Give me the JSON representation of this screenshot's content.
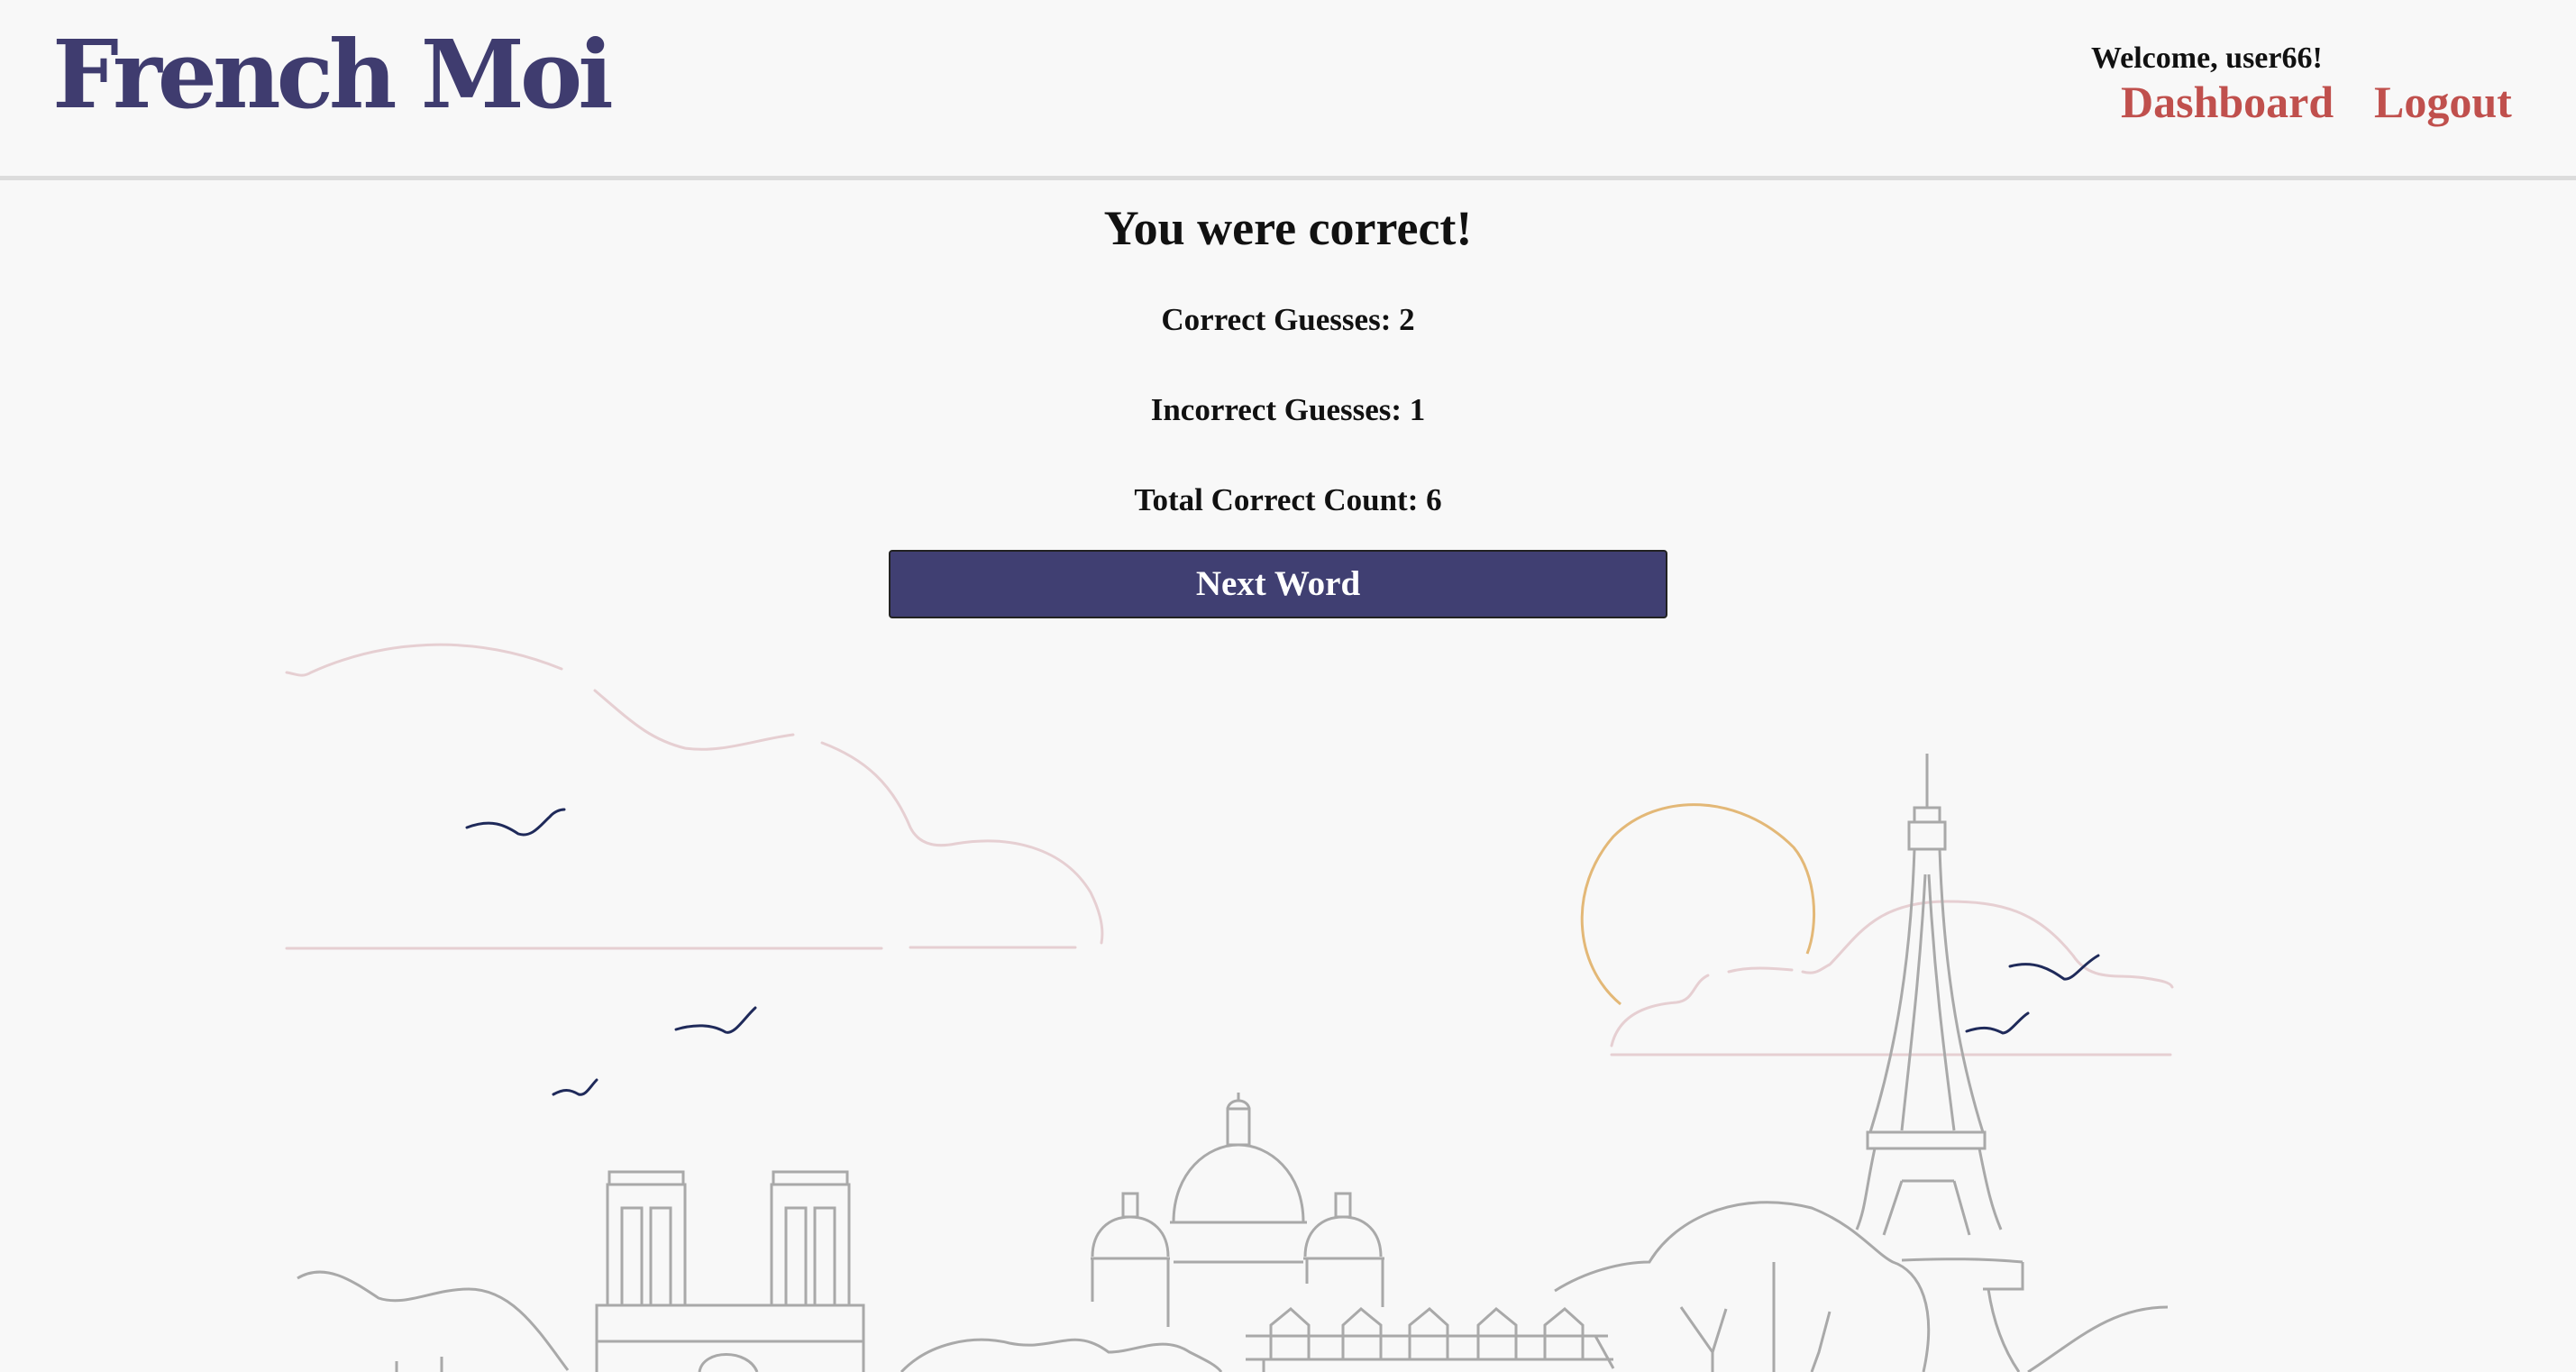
{
  "header": {
    "logo": "French Moi",
    "welcome": "Welcome, user66!",
    "nav": {
      "dashboard": "Dashboard",
      "logout": "Logout"
    }
  },
  "result": {
    "title": "You were correct!",
    "correct_guesses": "Correct Guesses: 2",
    "incorrect_guesses": "Incorrect Guesses: 1",
    "total_correct": "Total Correct Count: 6",
    "next_button": "Next Word"
  },
  "colors": {
    "brand": "#3f3c6f",
    "link": "#c0504d",
    "button": "#403f72",
    "sun": "#e3b877",
    "cloud": "#e6cfd2",
    "building": "#a9a9a9",
    "bird": "#1f2a5a"
  }
}
